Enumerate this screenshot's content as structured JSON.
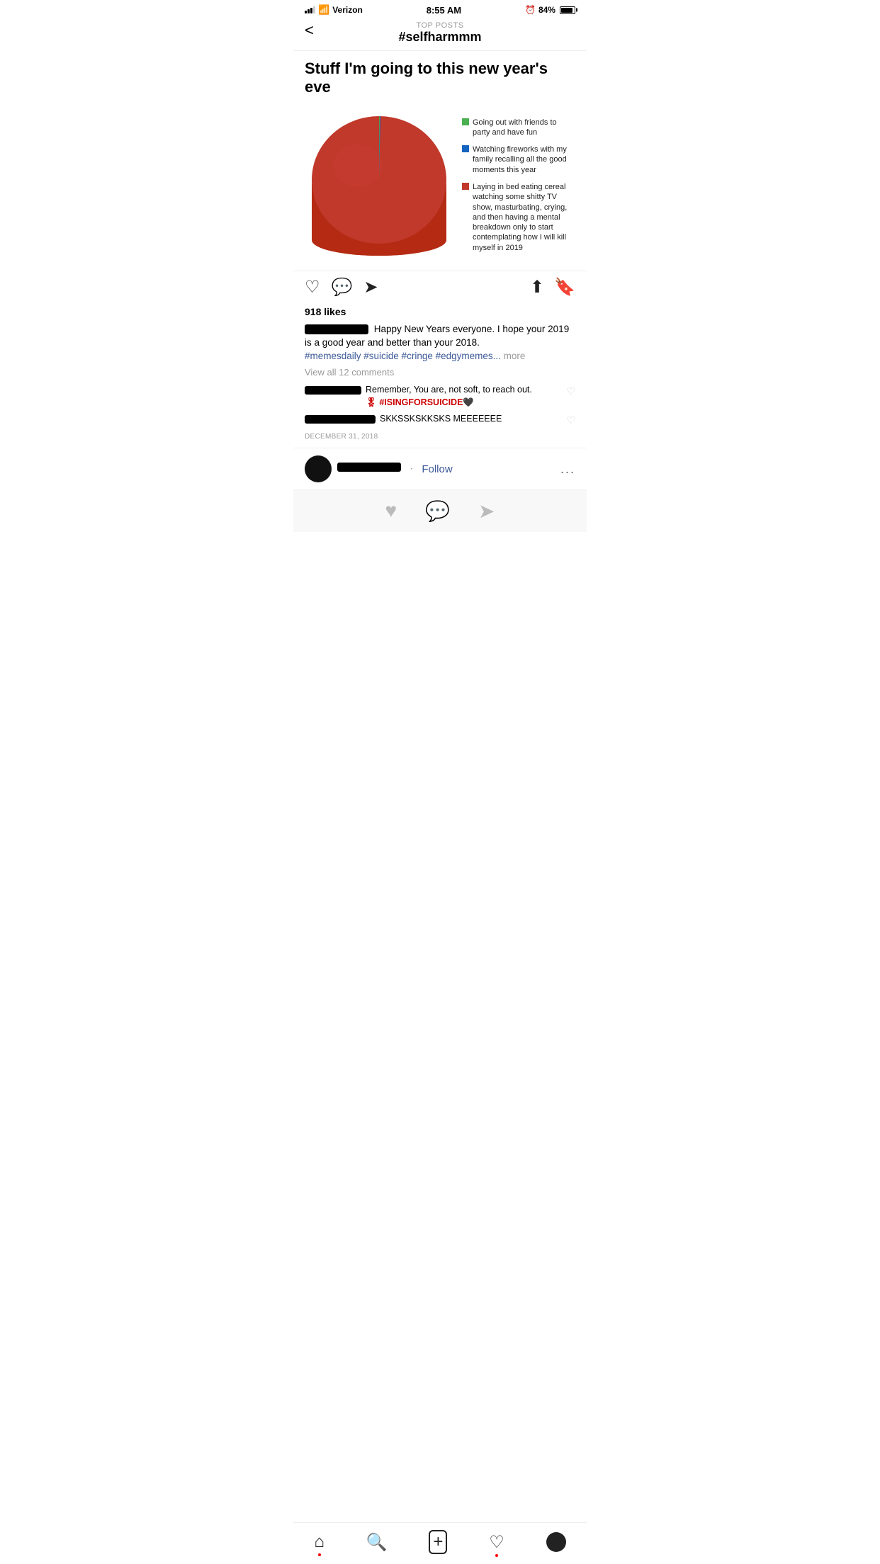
{
  "statusBar": {
    "carrier": "Verizon",
    "time": "8:55 AM",
    "battery": "84%"
  },
  "header": {
    "topLabel": "TOP POSTS",
    "title": "#selfharmmm",
    "backLabel": "<"
  },
  "post": {
    "chartTitle": "Stuff I'm going to this new year's eve",
    "legend": [
      {
        "color": "#4caf50",
        "text": "Going out with friends to party and have fun"
      },
      {
        "color": "#1565c0",
        "text": "Watching fireworks with my family recalling all the good moments this year"
      },
      {
        "color": "#c0392b",
        "text": "Laying in bed eating cereal watching some shitty TV show, masturbating, crying, and then having a mental breakdown only to start contemplating how I will kill myself in 2019"
      }
    ],
    "likes": "918 likes",
    "caption": "Happy New Years everyone. I hope your 2019 is a good year and better than your 2018.",
    "hashtags": "#memesdaily #suicide #cringe #edgymemes...",
    "moreLabel": "more",
    "viewComments": "View all 12 comments",
    "comments": [
      {
        "text": "Remember, You are, not soft, to reach out.",
        "special": "🎖 #ISINGFORSUICIDE🖤"
      },
      {
        "text": "SKKSSKSKKSKS MEEEEEEE"
      }
    ],
    "date": "DECEMBER 31, 2018"
  },
  "nextPost": {
    "followLabel": "Follow",
    "moreLabel": "..."
  },
  "bottomNav": {
    "items": [
      {
        "icon": "⌂",
        "name": "home"
      },
      {
        "icon": "⚲",
        "name": "search"
      },
      {
        "icon": "⊞",
        "name": "add"
      },
      {
        "icon": "♡",
        "name": "likes"
      },
      {
        "icon": "●",
        "name": "profile"
      }
    ]
  }
}
